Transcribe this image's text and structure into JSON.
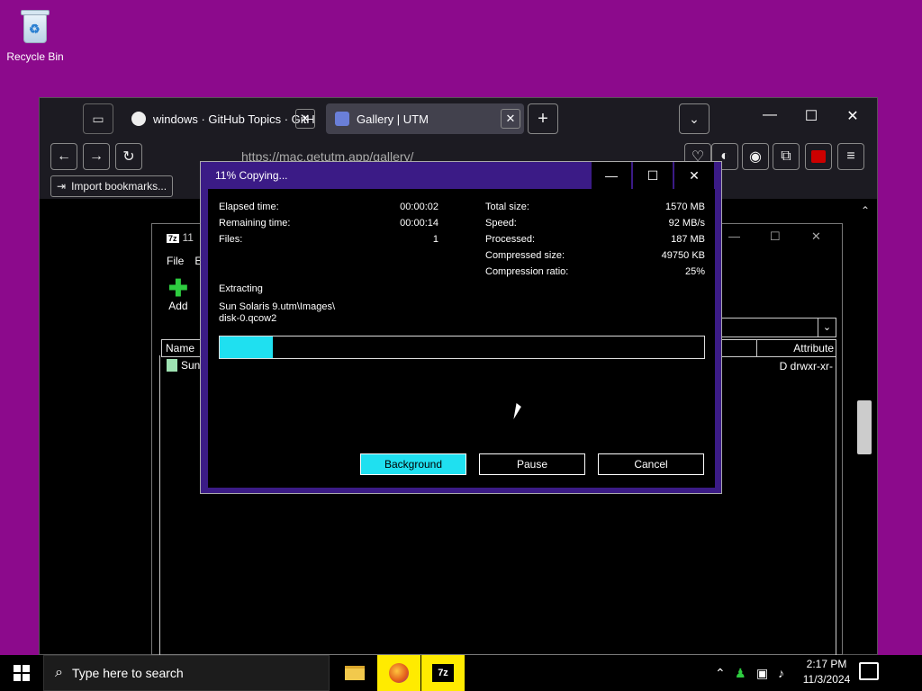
{
  "desktop": {
    "recycle_bin_label": "Recycle Bin"
  },
  "browser": {
    "tabs": [
      {
        "title": "windows · GitHub Topics · GitH",
        "icon": "github-icon"
      },
      {
        "title": "Gallery | UTM",
        "icon": "utm-icon"
      }
    ],
    "url": "https://mac.getutm.app/gallery/",
    "bookmark_label": "Import bookmarks..."
  },
  "zip_window": {
    "title": "11",
    "menu": [
      "File",
      "E"
    ],
    "add_label": "Add",
    "columns": {
      "name": "Name",
      "attributes": "Attribute"
    },
    "row": {
      "name": "Sun",
      "attributes": "D drwxr-xr-"
    }
  },
  "dialog": {
    "title": "11% Copying...",
    "left_stats": [
      {
        "label": "Elapsed time:",
        "value": "00:00:02"
      },
      {
        "label": "Remaining time:",
        "value": "00:00:14"
      },
      {
        "label": "Files:",
        "value": "1"
      }
    ],
    "right_stats": [
      {
        "label": "Total size:",
        "value": "1570 MB"
      },
      {
        "label": "Speed:",
        "value": "92 MB/s"
      },
      {
        "label": "Processed:",
        "value": "187 MB"
      },
      {
        "label": "Compressed size:",
        "value": "49750 KB"
      },
      {
        "label": "Compression ratio:",
        "value": "25%"
      }
    ],
    "operation": "Extracting",
    "file_line1": "Sun Solaris 9.utm\\Images\\",
    "file_line2": "disk-0.qcow2",
    "progress_percent": 11,
    "buttons": {
      "background": "Background",
      "pause": "Pause",
      "cancel": "Cancel"
    }
  },
  "taskbar": {
    "search_placeholder": "Type here to search",
    "time": "2:17 PM",
    "date": "11/3/2024",
    "apps": [
      "file-explorer-icon",
      "firefox-icon",
      "7zip-icon"
    ],
    "seven_zip_label": "7z"
  }
}
